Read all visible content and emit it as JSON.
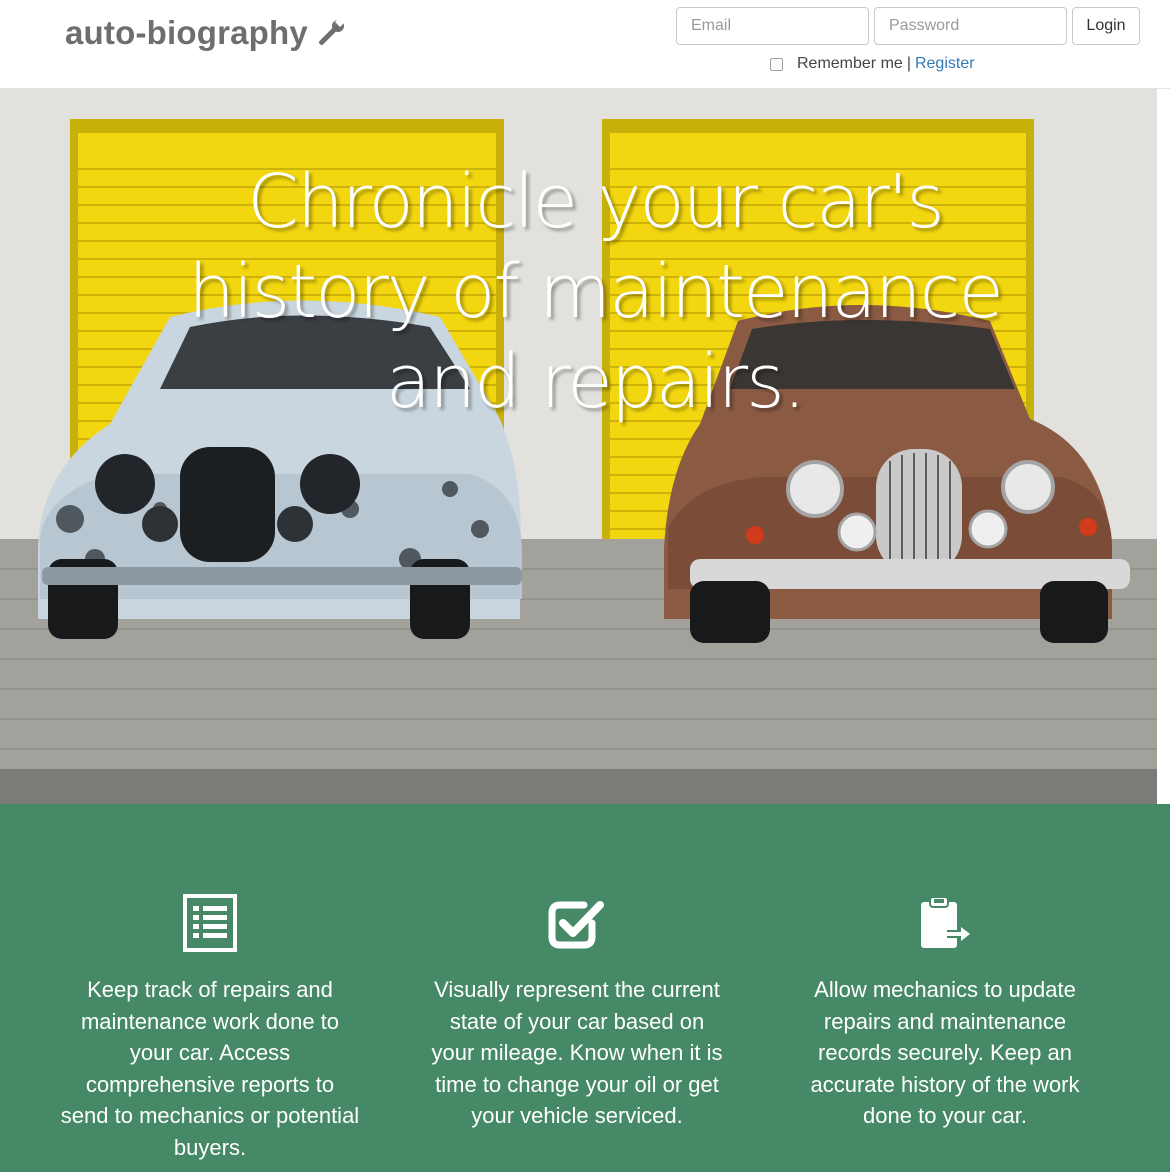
{
  "brand": {
    "name": "auto-biography",
    "icon": "wrench-icon"
  },
  "login_form": {
    "email_placeholder": "Email",
    "password_placeholder": "Password",
    "login_label": "Login",
    "remember_label": "Remember me",
    "separator": "|",
    "register_label": "Register"
  },
  "hero": {
    "headline": "Chronicle your car's history of maintenance and repairs.",
    "image": "two-vintage-cars-parked-before-yellow-garage-doors"
  },
  "features": [
    {
      "icon": "list-icon",
      "text": "Keep track of repairs and maintenance work done to your car. Access comprehensive reports to send to mechanics or potential buyers."
    },
    {
      "icon": "checkbox-icon",
      "text": "Visually represent the current state of your car based on your mileage. Know when it is time to change your oil or get your vehicle serviced."
    },
    {
      "icon": "clipboard-arrow-icon",
      "text": "Allow mechanics to update repairs and maintenance records securely. Keep an accurate history of the work done to your car."
    }
  ],
  "colors": {
    "features_background": "#468966",
    "link": "#337ab7",
    "brand_text": "#6e6e6e",
    "garage_door": "#f2d60f"
  }
}
